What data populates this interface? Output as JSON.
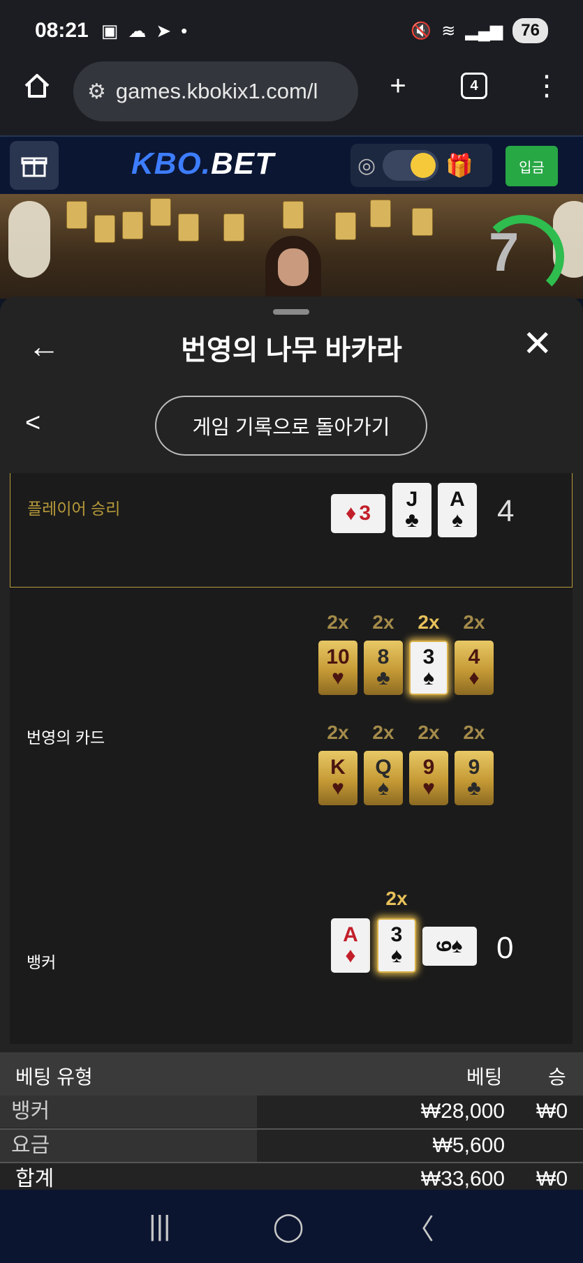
{
  "status_bar": {
    "time": "08:21",
    "battery": "76"
  },
  "browser": {
    "url": "games.kbokix1.com/l",
    "tab_count": "4"
  },
  "site": {
    "logo_kbo": "KBO.",
    "logo_bet": "BET",
    "deposit_label": "입금"
  },
  "video": {
    "timer": "7"
  },
  "panel": {
    "title": "번영의 나무 바카라",
    "back_to_history": "게임 기록으로 돌아가기",
    "player": {
      "label": "플레이어 승리",
      "score": "4",
      "cards": [
        {
          "rank": "3",
          "suit": "♦",
          "color": "red",
          "orientation": "horizontal"
        },
        {
          "rank": "J",
          "suit": "♣",
          "color": "black"
        },
        {
          "rank": "A",
          "suit": "♠",
          "color": "black"
        }
      ]
    },
    "prosperity": {
      "label": "번영의 카드",
      "row1": [
        {
          "mult": "2x",
          "rank": "10",
          "suit": "♥",
          "color": "red"
        },
        {
          "mult": "2x",
          "rank": "8",
          "suit": "♣",
          "color": "black"
        },
        {
          "mult": "2x",
          "rank": "3",
          "suit": "♠",
          "color": "black",
          "highlighted": true
        },
        {
          "mult": "2x",
          "rank": "4",
          "suit": "♦",
          "color": "red"
        }
      ],
      "row2": [
        {
          "mult": "2x",
          "rank": "K",
          "suit": "♥",
          "color": "red"
        },
        {
          "mult": "2x",
          "rank": "Q",
          "suit": "♠",
          "color": "black"
        },
        {
          "mult": "2x",
          "rank": "9",
          "suit": "♥",
          "color": "red"
        },
        {
          "mult": "2x",
          "rank": "9",
          "suit": "♣",
          "color": "black"
        }
      ]
    },
    "banker": {
      "label": "뱅커",
      "score": "0",
      "mult": "2x",
      "cards": [
        {
          "rank": "A",
          "suit": "♦",
          "color": "red"
        },
        {
          "rank": "3",
          "suit": "♠",
          "color": "black",
          "highlighted": true
        },
        {
          "rank": "9",
          "suit": "♠",
          "color": "black",
          "orientation": "horizontal"
        }
      ]
    }
  },
  "bet_table": {
    "headers": {
      "type": "베팅 유형",
      "bet": "베팅",
      "win": "승"
    },
    "rows": [
      {
        "label": "뱅커",
        "bet": "₩28,000",
        "win": "₩0"
      },
      {
        "label": "요금",
        "bet": "₩5,600",
        "win": ""
      }
    ],
    "total": {
      "label": "합계",
      "bet": "₩33,600",
      "win": "₩0"
    }
  }
}
